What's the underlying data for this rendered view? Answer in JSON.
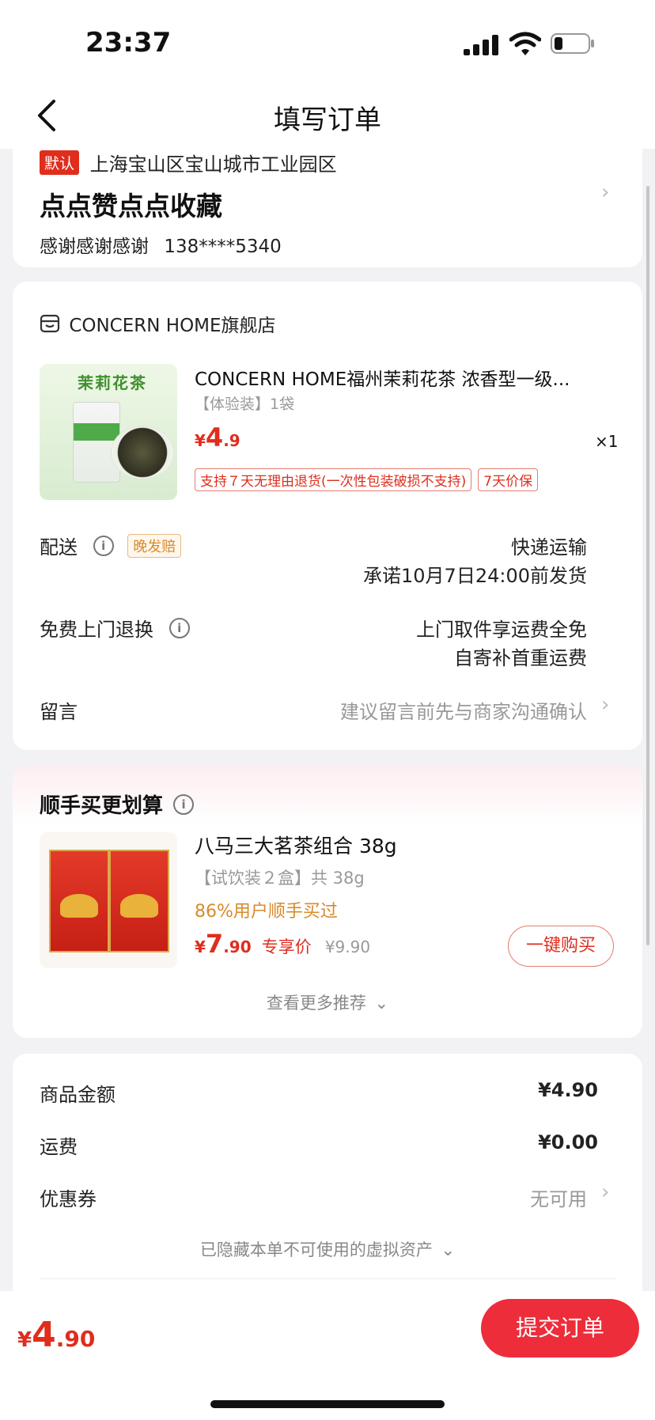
{
  "status_bar": {
    "time": "23:37"
  },
  "nav": {
    "title": "填写订单"
  },
  "address": {
    "default_tag": "默认",
    "region": "上海宝山区宝山城市工业园区",
    "detail": "点点赞点点收藏",
    "contact_name": "感谢感谢感谢",
    "phone": "138****5340"
  },
  "shop": {
    "name": "CONCERN HOME旗舰店",
    "product": {
      "title": "CONCERN HOME福州茉莉花茶 浓香型一级...",
      "spec": "【体验装】1袋",
      "price_symbol": "¥",
      "price_int": "4",
      "price_dec": ".9",
      "quantity": "×1",
      "image_caption": "茉莉花茶",
      "tags": [
        "支持７天无理由退货(一次性包装破损不支持)",
        "7天价保"
      ]
    },
    "delivery": {
      "label": "配送",
      "badge": "晚发赔",
      "method": "快递运输",
      "promise": "承诺10月7日24:00前发货"
    },
    "return": {
      "label": "免费上门退换",
      "line1": "上门取件享运费全免",
      "line2": "自寄补首重运费"
    },
    "message": {
      "label": "留言",
      "placeholder": "建议留言前先与商家沟通确认"
    }
  },
  "upsell": {
    "title": "顺手买更划算",
    "product": {
      "title": "八马三大茗茶组合 38g",
      "spec": "【试饮装２盒】共 38g",
      "social": "86%用户顺手买过",
      "price_symbol": "¥",
      "price_int": "7",
      "price_dec": ".90",
      "price_label": "专享价",
      "orig_price": "¥9.90",
      "buy_label": "一键购买"
    },
    "more": "查看更多推荐"
  },
  "summary": {
    "goods_label": "商品金额",
    "goods_value": "¥4.90",
    "shipping_label": "运费",
    "shipping_value": "¥0.00",
    "coupon_label": "优惠券",
    "coupon_value": "无可用",
    "hidden_note": "已隐藏本单不可使用的虚拟资产"
  },
  "bottom": {
    "total_symbol": "¥",
    "total_int": "4",
    "total_dec": ".90",
    "submit": "提交订单"
  },
  "colors": {
    "accent": "#e02d1c",
    "submit": "#ee2d3a",
    "orange": "#d88a2c"
  }
}
